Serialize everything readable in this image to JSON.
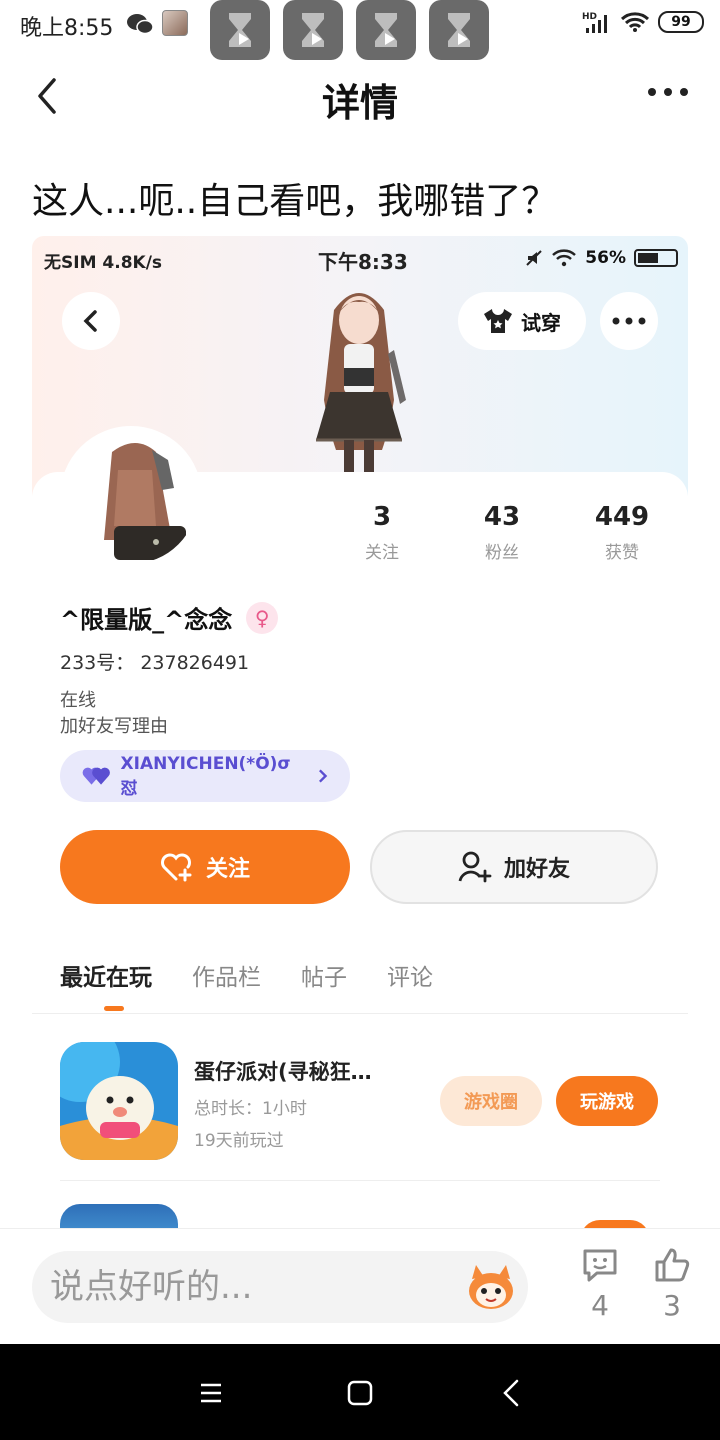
{
  "status_bar": {
    "time": "晚上8:55",
    "battery": "99",
    "icons": [
      "wechat-icon",
      "avatar-thumbnail",
      "hourglass-play-icon",
      "hd-signal-icon",
      "wifi-icon",
      "battery-icon"
    ]
  },
  "header": {
    "title": "详情"
  },
  "post": {
    "text": "这人...呃..自己看吧，我哪错了？"
  },
  "screenshot": {
    "status_left": "无SIM 4.8K/s",
    "status_time": "下午8:33",
    "status_battery": "56%",
    "tryon_label": "试穿",
    "stats": [
      {
        "num": "3",
        "label": "关注"
      },
      {
        "num": "43",
        "label": "粉丝"
      },
      {
        "num": "449",
        "label": "获赞"
      }
    ],
    "nickname": "^限量版_^念念",
    "gender": "female",
    "uid_label": "233号：",
    "uid": "237826491",
    "online": "在线",
    "friend_reason": "加好友写理由",
    "tag": "XIANYICHEN(*Ö)σ怼",
    "follow_label": "关注",
    "add_friend_label": "加好友",
    "tabs": [
      "最近在玩",
      "作品栏",
      "帖子",
      "评论"
    ],
    "active_tab": "最近在玩",
    "games": [
      {
        "name": "蛋仔派对(寻秘狂…",
        "duration": "总时长：1小时",
        "last_played": "19天前玩过",
        "circle_label": "游戏圈",
        "play_label": "玩游戏"
      }
    ]
  },
  "comment_bar": {
    "placeholder": "说点好听的...",
    "comments_count": "4",
    "likes_count": "3"
  },
  "colors": {
    "accent": "#f7781e",
    "tag_bg": "#e9e9fb",
    "tag_text": "#5a4ed1"
  }
}
